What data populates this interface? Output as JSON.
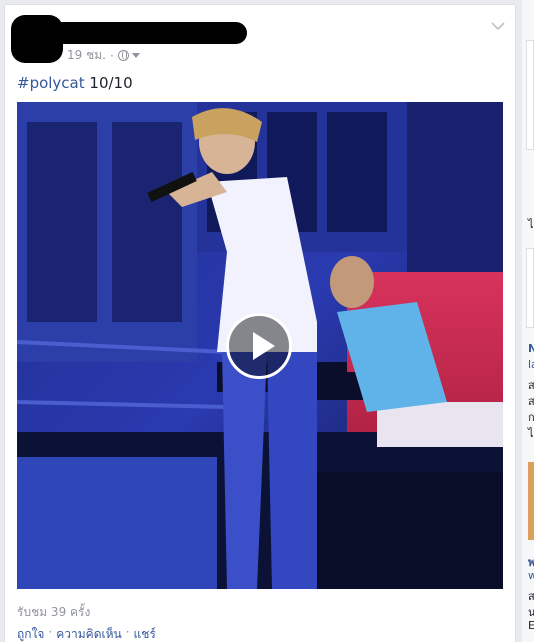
{
  "post": {
    "time": "19 ชม.",
    "separator": "·",
    "privacy_icon": "globe-icon",
    "menu_icon": "chevron-down-icon",
    "hashtag": "#polycat",
    "text_after_hashtag": " 10/10",
    "video": {
      "play_icon": "play-icon"
    },
    "views": "รับชม 39 ครั้ง",
    "actions": {
      "like": "ถูกใจ",
      "comment": "ความคิดเห็น",
      "share": "แชร์",
      "separator": "·"
    }
  },
  "sidebar_partial": {
    "chars": [
      "ไ",
      "N",
      "la",
      "ส",
      "ส",
      "ก",
      "ไ",
      "พ",
      "w",
      "ส",
      "น",
      "E"
    ]
  },
  "colors": {
    "link": "#365899",
    "muted": "#90949c",
    "text": "#1d2129",
    "background": "#e9ebee"
  }
}
